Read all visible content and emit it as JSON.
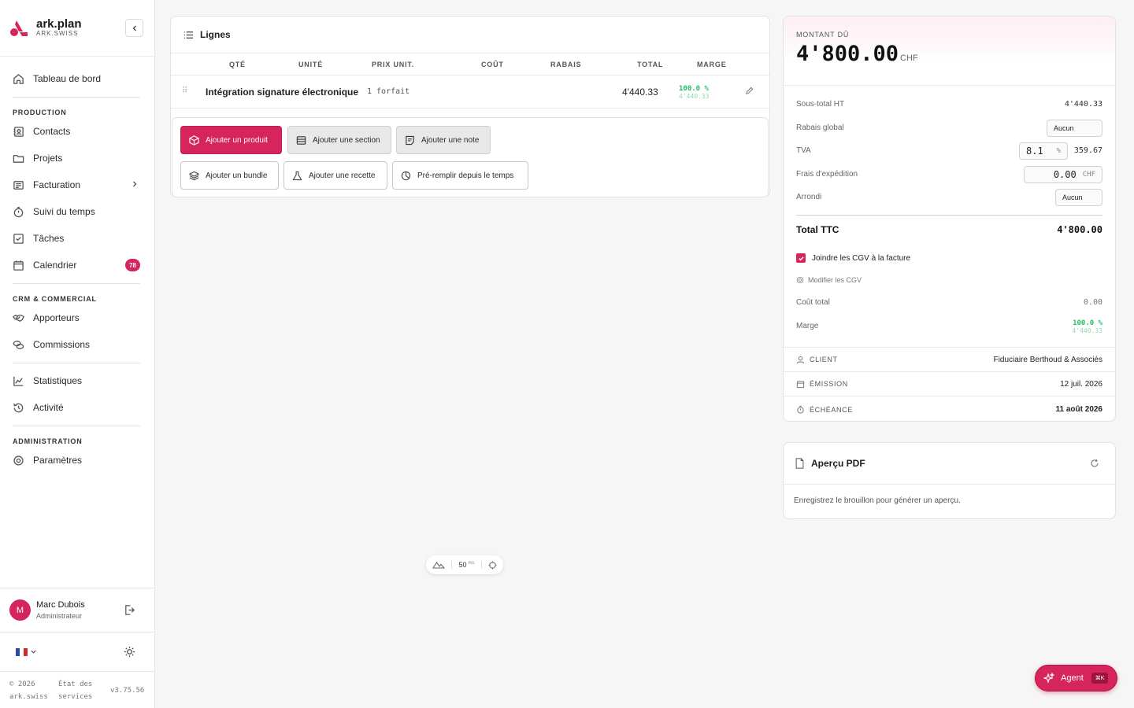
{
  "brand": {
    "name": "ark.plan",
    "sub": "ARK.SWISS"
  },
  "nav": {
    "dashboard": "Tableau de bord",
    "section_production": "PRODUCTION",
    "contacts": "Contacts",
    "projects": "Projets",
    "billing": "Facturation",
    "time": "Suivi du temps",
    "tasks": "Tâches",
    "calendar": "Calendrier",
    "calendar_badge": "78",
    "section_crm": "CRM & COMMERCIAL",
    "referrers": "Apporteurs",
    "commissions": "Commissions",
    "stats": "Statistiques",
    "activity": "Activité",
    "section_admin": "ADMINISTRATION",
    "settings": "Paramètres"
  },
  "user": {
    "initial": "M",
    "name": "Marc Dubois",
    "role": "Administrateur"
  },
  "footer": {
    "copyright_1": "© 2026",
    "copyright_2": "ark.swiss",
    "status_1": "État des",
    "status_2": "services",
    "version": "v3.75.56"
  },
  "lines": {
    "title": "Lignes",
    "columns": {
      "qty": "QTÉ",
      "unit": "UNITÉ",
      "unit_price": "PRIX UNIT.",
      "cost": "COÛT",
      "discount": "RABAIS",
      "total": "TOTAL",
      "margin": "MARGE"
    },
    "rows": [
      {
        "name": "Intégration signature électronique",
        "qty": "1 forfait",
        "total": "4'440.33",
        "margin": "100.0 %",
        "margin_value": "4'440.33"
      }
    ],
    "actions": {
      "add_product": "Ajouter un produit",
      "add_section": "Ajouter une section",
      "add_note": "Ajouter une note",
      "add_bundle": "Ajouter un bundle",
      "add_recipe": "Ajouter une recette",
      "prefill_time": "Pré-remplir depuis le temps"
    }
  },
  "summary": {
    "amount_label": "MONTANT DÛ",
    "amount": "4'800.00",
    "currency": "CHF",
    "subtotal_label": "Sous-total HT",
    "subtotal": "4'440.33",
    "discount_label": "Rabais global",
    "discount_value": "Aucun",
    "vat_label": "TVA",
    "vat_rate": "8.1",
    "vat_unit": "%",
    "vat_amount": "359.67",
    "shipping_label": "Frais d'expédition",
    "shipping_value": "0.00",
    "shipping_cur": "CHF",
    "rounding_label": "Arrondi",
    "rounding_value": "Aucun",
    "total_label": "Total TTC",
    "total_value": "4'800.00",
    "cgv_label": "Joindre les CGV à la facture",
    "edit_cgv": "Modifier les CGV",
    "cost_label": "Coût total",
    "cost_value": "0.00",
    "margin_label": "Marge",
    "margin_pct": "100.0 %",
    "margin_value": "4'440.33",
    "client_label": "CLIENT",
    "client_value": "Fiduciaire Berthoud & Associés",
    "issue_label": "ÉMISSION",
    "issue_value": "12 juil. 2026",
    "due_label": "ÉCHÉANCE",
    "due_value": "11 août 2026"
  },
  "pdf": {
    "title": "Aperçu PDF",
    "message": "Enregistrez le brouillon pour générer un aperçu."
  },
  "perf": {
    "value": "50",
    "unit": "ms"
  },
  "agent": {
    "label": "Agent",
    "shortcut": "⌘K"
  },
  "colors": {
    "accent": "#d6245c",
    "margin_green": "#1dbf62"
  }
}
